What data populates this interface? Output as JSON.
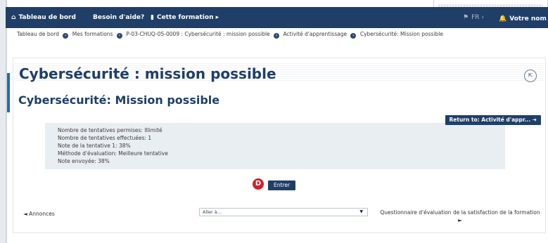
{
  "topbar": {
    "items": [
      {
        "label": "Tableau de bord",
        "icon": "home-icon"
      },
      {
        "label": "Besoin d'aide?"
      },
      {
        "label": "Cette formation ▸",
        "icon": "book-icon"
      }
    ],
    "language": "FR",
    "user": "Votre nom"
  },
  "breadcrumb": [
    "Tableau de bord",
    "Mes formations",
    "P-03-CHUQ-05-0009 : Cybersécurité : mission possible",
    "Activité d'apprentissage",
    "Cybersécurité: Mission possible"
  ],
  "page": {
    "title": "Cybersécurité : mission possible",
    "subtitle": "Cybersécurité: Mission possible",
    "return_button": "Return to: Activité d'appr...",
    "info": [
      "Nombre de tentatives permises: Illimité",
      "Nombre de tentatives effectuées: 1",
      "Note de la tentative 1: 38%",
      "Méthode d'évaluation: Meilleure tentative",
      "Note envoyée: 38%"
    ],
    "badge": "D",
    "enter_button": "Entrer",
    "prev_link": "◄ Annonces",
    "goto_select": "Aller à...",
    "next_link": "Questionnaire d'évaluation de la satisfaction de la formation ►"
  },
  "colors": {
    "navy": "#1f3f68",
    "badge_red": "#d1202a",
    "info_bg": "#e9eef3"
  }
}
